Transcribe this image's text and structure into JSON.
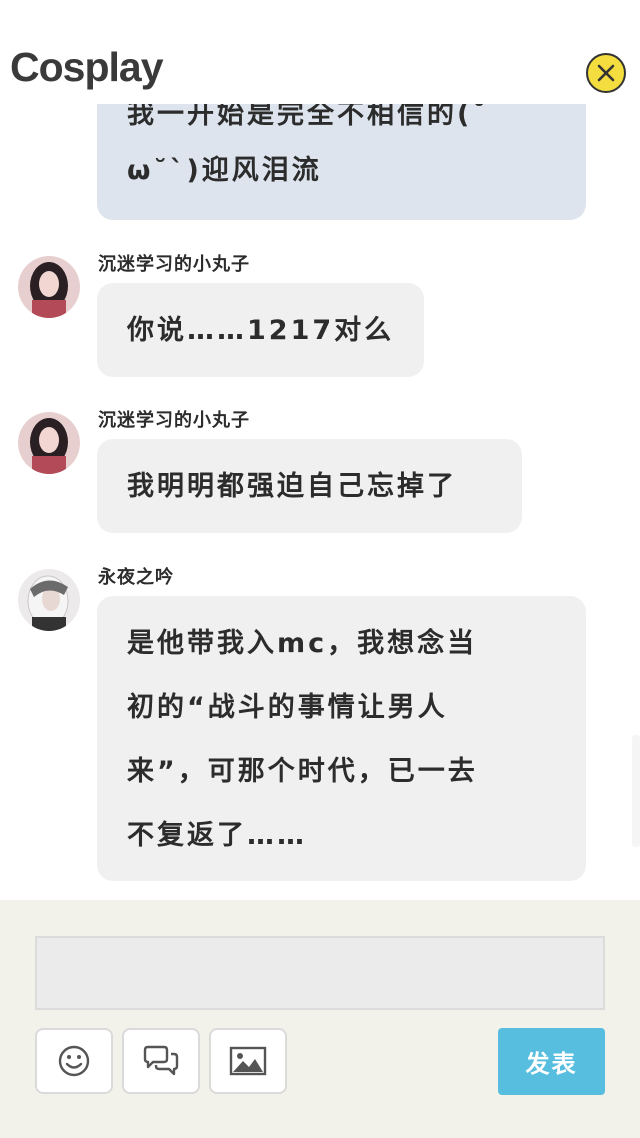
{
  "header": {
    "title": "Cosplay"
  },
  "messages": [
    {
      "user": "",
      "lines": [
        "我一开始是完全不相信的(˘",
        "ω˘`)迎风泪流"
      ]
    },
    {
      "user": "沉迷学习的小丸子",
      "lines": [
        "你说……1217对么"
      ]
    },
    {
      "user": "沉迷学习的小丸子",
      "lines": [
        "我明明都强迫自己忘掉了"
      ]
    },
    {
      "user": "永夜之吟",
      "lines": [
        "是他带我入mc，我想念当",
        "初的“战斗的事情让男人",
        "来”，可那个时代，已一去",
        "不复返了……"
      ]
    }
  ],
  "composer": {
    "input_value": "",
    "send_label": "发表"
  },
  "icons": {
    "close": "close-icon",
    "emoji": "emoji-icon",
    "chat": "chat-bubbles-icon",
    "image": "image-icon"
  },
  "colors": {
    "send_button": "#58bee0",
    "close_button": "#f3dd3f",
    "composer_bg": "#f3f2ea"
  }
}
